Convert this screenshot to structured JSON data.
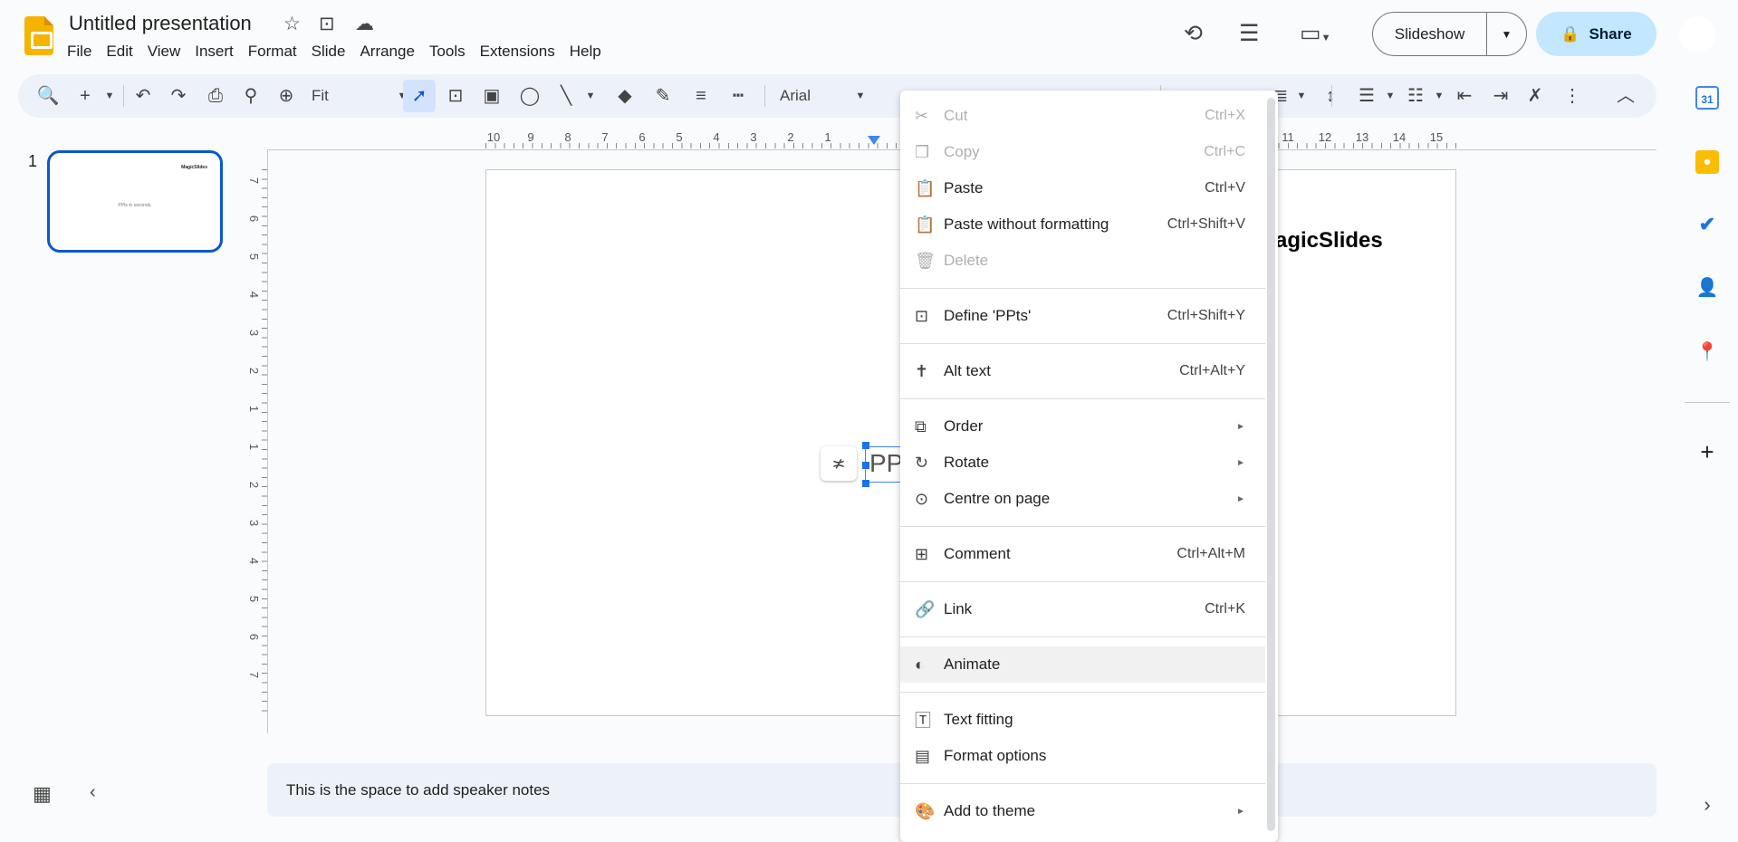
{
  "app": {
    "title": "Untitled presentation"
  },
  "menubar": [
    "File",
    "Edit",
    "View",
    "Insert",
    "Format",
    "Slide",
    "Arrange",
    "Tools",
    "Extensions",
    "Help"
  ],
  "header": {
    "slideshow_label": "Slideshow",
    "share_label": "Share"
  },
  "toolbar": {
    "zoom_value": "Fit",
    "font_value": "Arial"
  },
  "ruler": {
    "h_labels": [
      "10",
      "9",
      "8",
      "7",
      "6",
      "5",
      "4",
      "3",
      "2",
      "1",
      "11",
      "12",
      "13",
      "14",
      "15"
    ],
    "v_labels": [
      "7",
      "6",
      "5",
      "4",
      "3",
      "2",
      "1",
      "1",
      "2",
      "3",
      "4",
      "5",
      "6",
      "7"
    ]
  },
  "thumbnail": {
    "number": "1",
    "brand": "MagicSlides",
    "text": "PPts in seconds."
  },
  "slide": {
    "brand_text": "agicSlides",
    "text_partial": "PP"
  },
  "notes": {
    "placeholder": "This is the space to add speaker notes"
  },
  "context_menu": [
    {
      "icon": "scissors-icon",
      "glyph": "✂",
      "label": "Cut",
      "shortcut": "Ctrl+X",
      "disabled": true
    },
    {
      "icon": "copy-icon",
      "glyph": "❐",
      "label": "Copy",
      "shortcut": "Ctrl+C",
      "disabled": true
    },
    {
      "icon": "paste-icon",
      "glyph": "📋",
      "label": "Paste",
      "shortcut": "Ctrl+V"
    },
    {
      "icon": "paste-plain-icon",
      "glyph": "📋",
      "label": "Paste without formatting",
      "shortcut": "Ctrl+Shift+V"
    },
    {
      "icon": "trash-icon",
      "glyph": "🗑",
      "label": "Delete",
      "disabled": true,
      "sep_after": true
    },
    {
      "icon": "define-icon",
      "glyph": "⊡",
      "label": "Define 'PPts'",
      "shortcut": "Ctrl+Shift+Y",
      "sep_after": true
    },
    {
      "icon": "accessibility-icon",
      "glyph": "✝",
      "label": "Alt text",
      "shortcut": "Ctrl+Alt+Y",
      "sep_after": true
    },
    {
      "icon": "order-icon",
      "glyph": "⧉",
      "label": "Order",
      "submenu": true
    },
    {
      "icon": "rotate-icon",
      "glyph": "↻",
      "label": "Rotate",
      "submenu": true
    },
    {
      "icon": "centre-icon",
      "glyph": "⊙",
      "label": "Centre on page",
      "submenu": true,
      "sep_after": true
    },
    {
      "icon": "comment-icon",
      "glyph": "⊞",
      "label": "Comment",
      "shortcut": "Ctrl+Alt+M",
      "sep_after": true
    },
    {
      "icon": "link-icon",
      "glyph": "🔗",
      "label": "Link",
      "shortcut": "Ctrl+K",
      "sep_after": true
    },
    {
      "icon": "animate-icon",
      "glyph": "◐",
      "label": "Animate",
      "hover": true,
      "sep_after": true
    },
    {
      "icon": "text-fitting-icon",
      "glyph": "🅃",
      "label": "Text fitting"
    },
    {
      "icon": "format-options-icon",
      "glyph": "▤",
      "label": "Format options",
      "sep_after": true
    },
    {
      "icon": "palette-icon",
      "glyph": "🎨",
      "label": "Add to theme",
      "submenu": true
    }
  ],
  "colors": {
    "accent": "#0b57d0",
    "share_bg": "#c2e7ff",
    "toolbar_bg": "#edf2fa"
  }
}
